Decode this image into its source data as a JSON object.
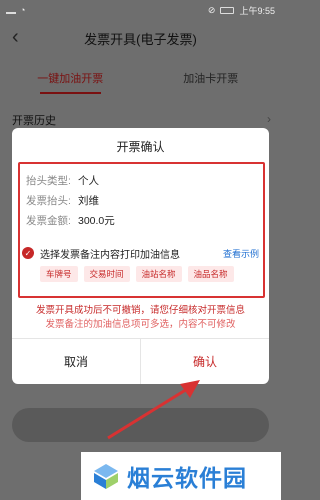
{
  "statusbar": {
    "time": "上午9:55"
  },
  "nav": {
    "title": "发票开具(电子发票)"
  },
  "tabs": [
    {
      "label": "一键加油开票"
    },
    {
      "label": "加油卡开票"
    }
  ],
  "history": {
    "label": "开票历史"
  },
  "dialog": {
    "title": "开票确认",
    "fields": [
      {
        "label": "抬头类型:",
        "value": "个人"
      },
      {
        "label": "发票抬头:",
        "value": "刘维"
      },
      {
        "label": "发票金额:",
        "value": "300.0元"
      }
    ],
    "remark_label": "选择发票备注内容打印加油信息",
    "example_link": "查看示例",
    "chips": [
      "车牌号",
      "交易时间",
      "油站名称",
      "油品名称"
    ],
    "warning_1": "发票开具成功后不可撤销，请您仔细核对开票信息",
    "warning_2": "发票备注的加油信息项可多选，内容不可修改",
    "cancel_label": "取消",
    "confirm_label": "确认"
  },
  "watermark": {
    "text": "烟云软件园"
  },
  "colors": {
    "accent": "#c62828",
    "highlight_box": "#d83232",
    "link": "#1f6fd1"
  }
}
